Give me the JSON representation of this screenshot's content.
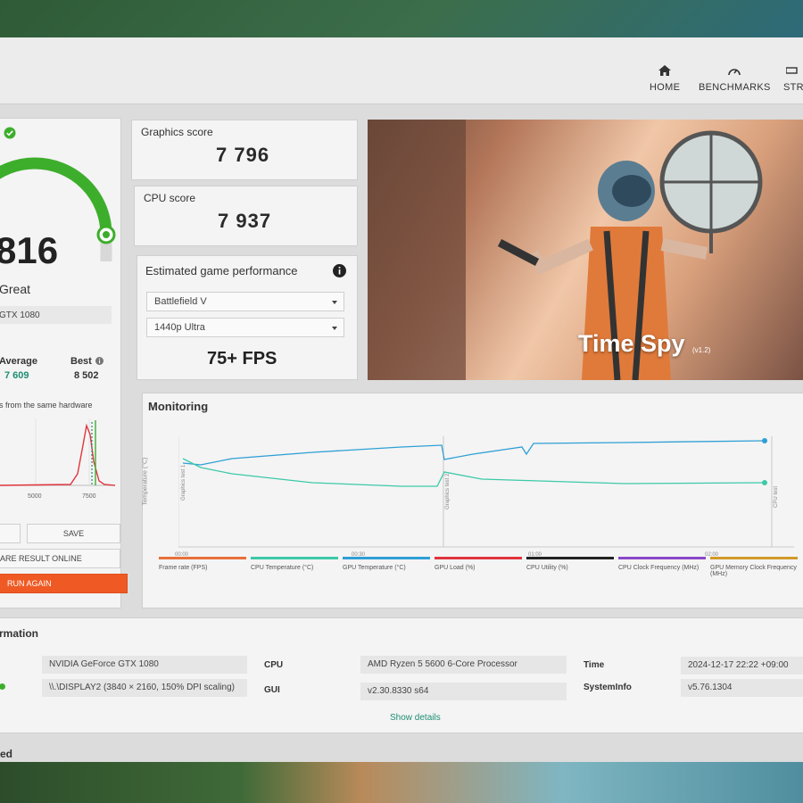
{
  "nav": {
    "home": "HOME",
    "benchmarks": "BENCHMARKS",
    "stress": "STR"
  },
  "score_card": {
    "score": "816",
    "rating": "Great",
    "gpu": "GTX 1080",
    "average_label": "Average",
    "average_value": "7 609",
    "best_label": "Best",
    "best_value": "8 502",
    "hist_caption": "s from the same hardware",
    "hist_tick_1": "5000",
    "hist_tick_2": "7500",
    "save_label": "SAVE",
    "share_label": "ARE RESULT ONLINE",
    "run_label": "RUN AGAIN"
  },
  "graphics": {
    "label": "Graphics score",
    "value": "7 796"
  },
  "cpu": {
    "label": "CPU score",
    "value": "7 937"
  },
  "estimate": {
    "title": "Estimated game performance",
    "game": "Battlefield V",
    "preset": "1440p Ultra",
    "fps": "75+ FPS"
  },
  "hero": {
    "title": "Time Spy",
    "version": "(v1.2)"
  },
  "monitoring": {
    "title": "Monitoring",
    "y_axis": "Temperature (°C)",
    "x_ticks": [
      "00:00",
      "00:30",
      "01:00",
      "01:30",
      "02:00"
    ],
    "markers": [
      "Graphics test 1",
      "Graphics test 2",
      "CPU test"
    ],
    "legend": [
      {
        "label": "Frame rate (FPS)",
        "color": "#e8703a"
      },
      {
        "label": "CPU Temperature (°C)",
        "color": "#3cc9a7"
      },
      {
        "label": "GPU Temperature (°C)",
        "color": "#2e9fd6"
      },
      {
        "label": "GPU Load (%)",
        "color": "#e0343d"
      },
      {
        "label": "CPU Utility (%)",
        "color": "#222222"
      },
      {
        "label": "CPU Clock Frequency (MHz)",
        "color": "#8a47c9"
      },
      {
        "label": "GPU Memory Clock Frequency (MHz)",
        "color": "#d19a2a"
      }
    ]
  },
  "sysinfo": {
    "title": "rmation",
    "gpu_value": "NVIDIA GeForce GTX 1080",
    "display_value": "\\\\.\\DISPLAY2 (3840 × 2160, 150% DPI scaling)",
    "cpu_label": "CPU",
    "cpu_value": "AMD Ryzen 5 5600 6-Core Processor",
    "gui_label": "GUI",
    "gui_value": "v2.30.8330 s64",
    "time_label": "Time",
    "time_value": "2024-12-17 22:22 +09:00",
    "sysinfo_label": "SystemInfo",
    "sysinfo_value": "v5.76.1304",
    "details_link": "Show details"
  },
  "footer_fragment": "ed",
  "colors": {
    "accent_green": "#3dae2b",
    "accent_orange": "#ef5a24",
    "link_teal": "#1f8d74"
  }
}
